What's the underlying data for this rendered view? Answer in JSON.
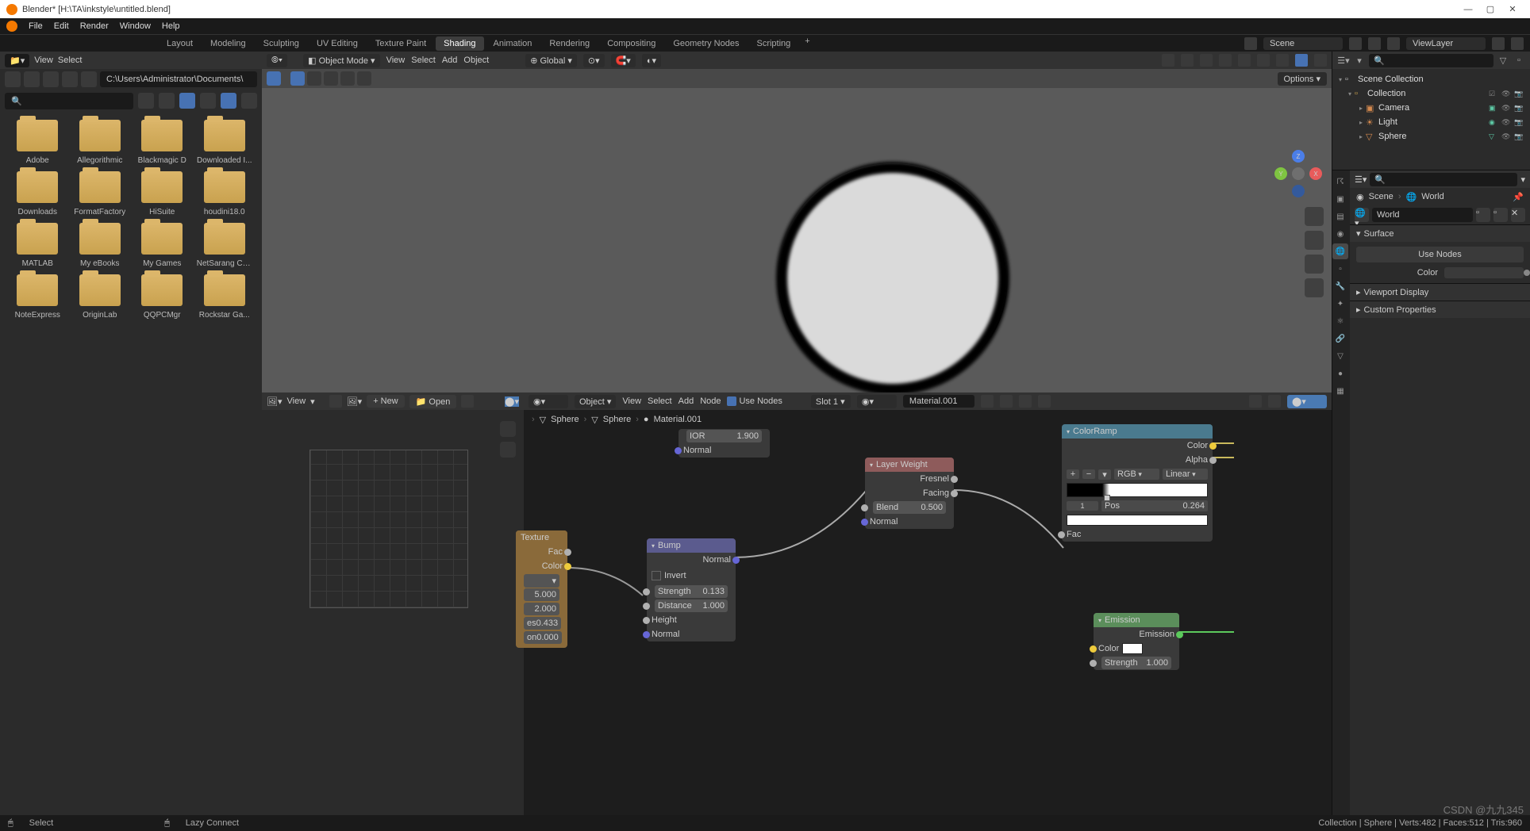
{
  "title": "Blender* [H:\\TA\\inkstyle\\untitled.blend]",
  "menus": [
    "File",
    "Edit",
    "Render",
    "Window",
    "Help"
  ],
  "workspaces": {
    "tabs": [
      "Layout",
      "Modeling",
      "Sculpting",
      "UV Editing",
      "Texture Paint",
      "Shading",
      "Animation",
      "Rendering",
      "Compositing",
      "Geometry Nodes",
      "Scripting"
    ],
    "active": "Shading"
  },
  "scene": "Scene",
  "viewlayer": "ViewLayer",
  "filebrowser": {
    "view_label": "View",
    "select_label": "Select",
    "path": "C:\\Users\\Administrator\\Documents\\",
    "folders": [
      "Adobe",
      "Allegorithmic",
      "Blackmagic D",
      "Downloaded I...",
      "Downloads",
      "FormatFactory",
      "HiSuite",
      "houdini18.0",
      "MATLAB",
      "My eBooks",
      "My Games",
      "NetSarang Co...",
      "NoteExpress",
      "OriginLab",
      "QQPCMgr",
      "Rockstar Ga..."
    ]
  },
  "viewport": {
    "mode": "Object Mode",
    "view": "View",
    "select": "Select",
    "add": "Add",
    "object": "Object",
    "orient": "Global",
    "options": "Options",
    "axes": {
      "x": "X",
      "y": "Y",
      "z": "Z"
    }
  },
  "image_editor": {
    "view": "View",
    "new": "New",
    "open": "Open"
  },
  "node_editor": {
    "object": "Object",
    "view": "View",
    "select": "Select",
    "add": "Add",
    "node": "Node",
    "use_nodes": "Use Nodes",
    "slot": "Slot 1",
    "material": "Material.001",
    "breadcrumb": [
      "Sphere",
      "Sphere",
      "Material.001"
    ],
    "ior_lbl": "IOR",
    "ior_val": "1.900",
    "normal_lbl": "Normal",
    "tex": {
      "hdr": "Texture",
      "fac": "Fac",
      "color": "Color",
      "v1": "5.000",
      "v2": "2.000",
      "v3_l": "es",
      "v3": "0.433",
      "v4_l": "on",
      "v4": "0.000"
    },
    "bump": {
      "hdr": "Bump",
      "normal_out": "Normal",
      "invert": "Invert",
      "strength_l": "Strength",
      "strength": "0.133",
      "distance_l": "Distance",
      "distance": "1.000",
      "height": "Height",
      "normal_in": "Normal"
    },
    "layer": {
      "hdr": "Layer Weight",
      "fresnel": "Fresnel",
      "facing": "Facing",
      "blend_l": "Blend",
      "blend": "0.500",
      "normal": "Normal"
    },
    "ramp": {
      "hdr": "ColorRamp",
      "color_out": "Color",
      "alpha_out": "Alpha",
      "rgb": "RGB",
      "linear": "Linear",
      "idx": "1",
      "pos_l": "Pos",
      "pos": "0.264",
      "fac": "Fac"
    },
    "emit": {
      "hdr": "Emission",
      "emit_out": "Emission",
      "color": "Color",
      "strength_l": "Strength",
      "strength": "1.000"
    }
  },
  "outliner": {
    "root": "Scene Collection",
    "collection": "Collection",
    "items": [
      {
        "name": "Camera"
      },
      {
        "name": "Light"
      },
      {
        "name": "Sphere"
      }
    ]
  },
  "properties": {
    "bread_scene": "Scene",
    "bread_world": "World",
    "world": "World",
    "surface": "Surface",
    "use_nodes": "Use Nodes",
    "color_lbl": "Color",
    "viewport_display": "Viewport Display",
    "custom_props": "Custom Properties"
  },
  "status": {
    "left": "Select",
    "mid": "Lazy Connect",
    "right": "Collection | Sphere | Verts:482 | Faces:512 | Tris:960"
  },
  "watermark": "CSDN @九九345"
}
